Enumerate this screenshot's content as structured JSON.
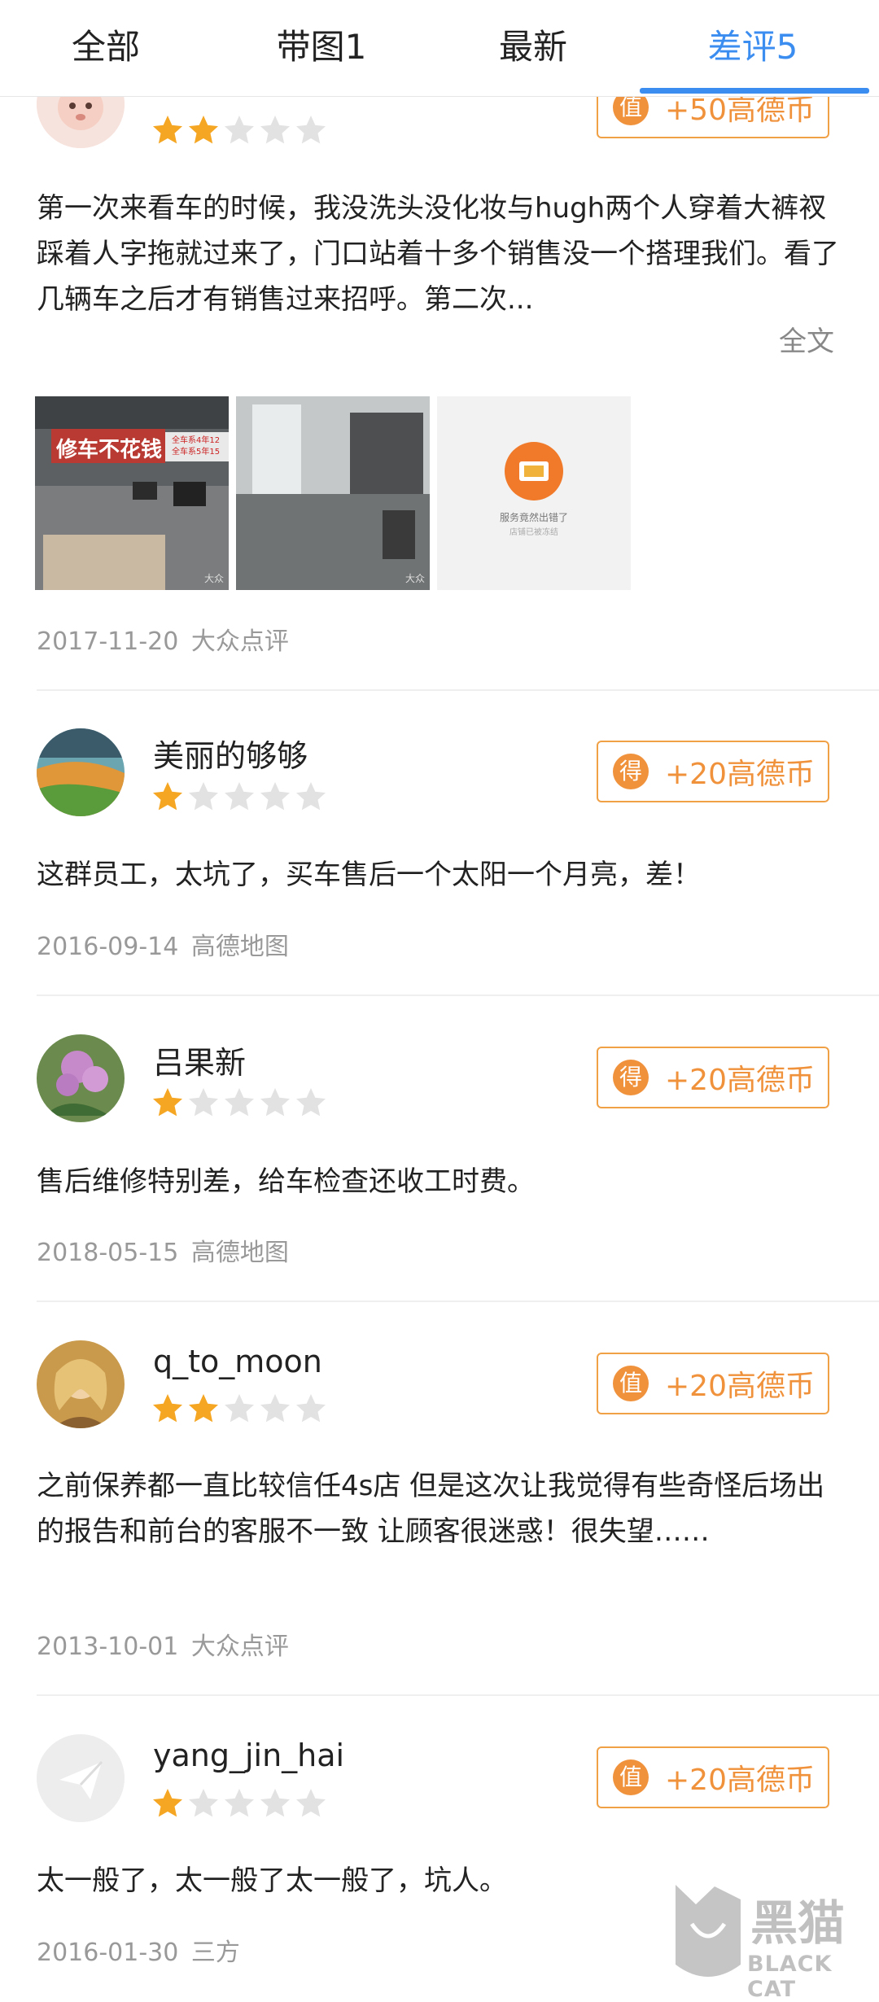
{
  "tabs": [
    {
      "label": "全部"
    },
    {
      "label": "带图1"
    },
    {
      "label": "最新"
    },
    {
      "label": "差评5"
    }
  ],
  "active_tab_index": 3,
  "reviews": [
    {
      "username": "",
      "rating": 2,
      "reward": {
        "badge": "值",
        "text": "+50高德币"
      },
      "content": "第一次来看车的时候，我没洗头没化妆与hugh两个人穿着大裤衩踩着人字拖就过来了，门口站着十多个销售没一个搭理我们。看了几辆车之后才有销售过来招呼。第二次...",
      "fulltext_label": "全文",
      "photos": [
        {
          "banner": "修车不花钱",
          "side": "全车系4年12 全车系5年15",
          "mark": "大众"
        },
        {
          "mark": "大众"
        },
        {
          "error_text": "服务竟然出错了",
          "error_sub": "店铺已被冻结"
        }
      ],
      "date": "2017-11-20",
      "source": "大众点评"
    },
    {
      "username": "美丽的够够",
      "rating": 1,
      "reward": {
        "badge": "得",
        "text": "+20高德币"
      },
      "content": "这群员工，太坑了，买车售后一个太阳一个月亮，差！",
      "date": "2016-09-14",
      "source": "高德地图"
    },
    {
      "username": "吕果新",
      "rating": 1,
      "reward": {
        "badge": "得",
        "text": "+20高德币"
      },
      "content": "售后维修特别差，给车检查还收工时费。",
      "date": "2018-05-15",
      "source": "高德地图"
    },
    {
      "username": "q_to_moon",
      "rating": 2,
      "reward": {
        "badge": "值",
        "text": "+20高德币"
      },
      "content": "之前保养都一直比较信任4s店 但是这次让我觉得有些奇怪后场出的报告和前台的客服不一致 让顾客很迷惑！很失望……",
      "date": "2013-10-01",
      "source": "大众点评"
    },
    {
      "username": "yang_jin_hai",
      "rating": 1,
      "reward": {
        "badge": "值",
        "text": "+20高德币"
      },
      "content": "太一般了，太一般了太一般了，坑人。",
      "date": "2016-01-30",
      "source": "三方"
    }
  ],
  "watermark": {
    "cn": "黑猫",
    "en": "BLACK CAT"
  },
  "colors": {
    "accent": "#3c8df0",
    "reward": "#f0913b",
    "star_on": "#f5a623",
    "star_off": "#e2e2e2"
  }
}
